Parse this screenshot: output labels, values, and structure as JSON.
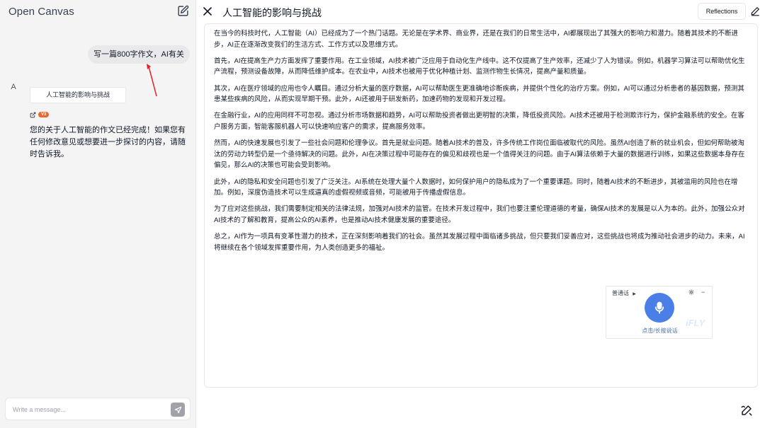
{
  "app": {
    "title": "Open Canvas"
  },
  "chat": {
    "user_message": "写一篇800字作文，AI有关",
    "assistant_avatar": "A",
    "artifact_card_title": "人工智能的影响与挑战",
    "badge_text": "V3",
    "assistant_reply": "您的关于人工智能的作文已经完成！如果您有任何修改意见或想要进一步探讨的内容，请随时告诉我。",
    "input_placeholder": "Write a message...",
    "input_value": ""
  },
  "canvas": {
    "title": "人工智能的影响与挑战",
    "reflections_label": "Reflections",
    "paragraphs": [
      "在当今的科技时代，人工智能（AI）已经成为了一个热门话题。无论是在学术界、商业界，还是在我们的日常生活中，AI都展现出了其强大的影响力和潜力。随着其技术的不断进步，AI正在逐渐改变我们的生活方式、工作方式以及思维方式。",
      "首先，AI在提高生产力方面发挥了重要作用。在工业领域，AI技术被广泛应用于自动化生产线中。这不仅提高了生产效率，还减少了人为错误。例如，机器学习算法可以帮助优化生产流程，预测设备故障，从而降低维护成本。在农业中，AI技术也被用于优化种植计划、监测作物生长情况，提高产量和质量。",
      "其次，AI在医疗领域的应用也令人瞩目。通过分析大量的医疗数据，AI可以帮助医生更准确地诊断疾病，并提供个性化的治疗方案。例如，AI可以通过分析患者的基因数据，预测其患某些疾病的风险，从而实现早期干预。此外，AI还被用于研发新药，加速药物的发现和开发过程。",
      "在金融行业，AI的应用同样不可忽视。通过分析市场数据和趋势，AI可以帮助投资者做出更明智的决策，降低投资风险。AI技术还被用于检测欺诈行为，保护金融系统的安全。在客户服务方面，智能客服机器人可以快速响应客户的需求，提高服务效率。",
      "然而，AI的快速发展也引发了一些社会问题和伦理争议。首先是就业问题。随着AI技术的普及，许多传统工作岗位面临被取代的风险。虽然AI创造了新的就业机会，但如何帮助被淘汰的劳动力转型仍是一个亟待解决的问题。此外，AI在决策过程中可能存在的偏见和歧视也是一个值得关注的问题。由于AI算法依赖于大量的数据进行训练，如果这些数据本身存在偏见，那么AI的决策也可能会受到影响。",
      "此外，AI的隐私和安全问题也引发了广泛关注。AI系统在处理大量个人数据时，如何保护用户的隐私成为了一个重要课题。同时，随着AI技术的不断进步，其被滥用的风险也在增加。例如，深度伪造技术可以生成逼真的虚假视频或音频，可能被用于传播虚假信息。",
      "为了应对这些挑战，我们需要制定相关的法律法规，加强对AI技术的监管。在技术开发过程中，我们也要注重伦理道德的考量，确保AI技术的发展是以人为本的。此外，加强公众对AI技术的了解和教育，提高公众的AI素养，也是推动AI技术健康发展的重要途径。",
      "总之，AI作为一项具有变革性潜力的技术，正在深刻影响着我们的社会。虽然其发展过程中面临诸多挑战，但只要我们妥善应对，这些挑战也将成为推动社会进步的动力。未来，AI将继续在各个领域发挥重要作用，为人类创造更多的福祉。"
    ]
  },
  "voice_widget": {
    "language_label": "普通话",
    "hint": "点击/长按说话",
    "minimize_label": "−",
    "watermark": "iFLY",
    "accent_color": "#4a7fe8"
  },
  "icons": {
    "new_chat": "new-chat-icon",
    "close": "close-icon",
    "edit": "edit-icon",
    "send": "send-icon",
    "external_link": "external-link-icon",
    "microphone": "microphone-icon",
    "settings": "gear-icon",
    "annotation_arrow": "red-arrow-annotation"
  }
}
